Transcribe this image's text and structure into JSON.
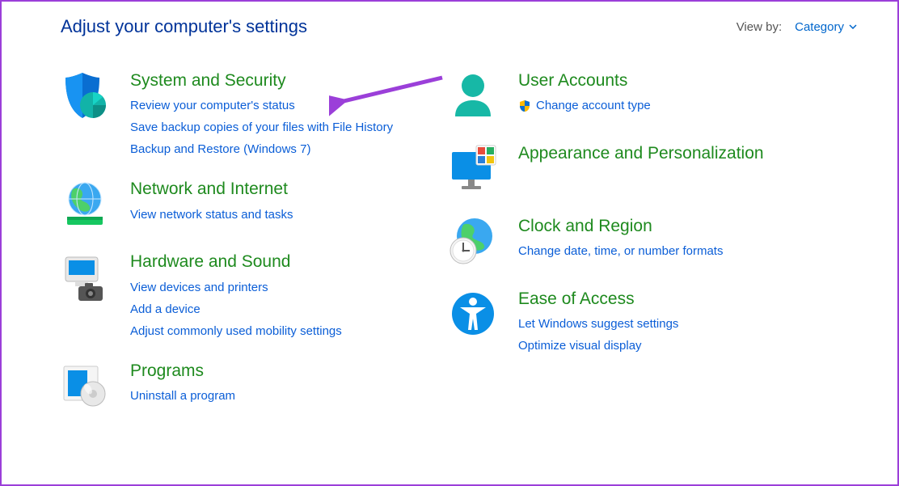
{
  "header": {
    "title": "Adjust your computer's settings",
    "viewby_label": "View by:",
    "viewby_mode": "Category"
  },
  "left": [
    {
      "title": "System and Security",
      "links": [
        "Review your computer's status",
        "Save backup copies of your files with File History",
        "Backup and Restore (Windows 7)"
      ]
    },
    {
      "title": "Network and Internet",
      "links": [
        "View network status and tasks"
      ]
    },
    {
      "title": "Hardware and Sound",
      "links": [
        "View devices and printers",
        "Add a device",
        "Adjust commonly used mobility settings"
      ]
    },
    {
      "title": "Programs",
      "links": [
        "Uninstall a program"
      ]
    }
  ],
  "right": [
    {
      "title": "User Accounts",
      "links": [
        "Change account type"
      ],
      "shield": true
    },
    {
      "title": "Appearance and Personalization",
      "links": []
    },
    {
      "title": "Clock and Region",
      "links": [
        "Change date, time, or number formats"
      ]
    },
    {
      "title": "Ease of Access",
      "links": [
        "Let Windows suggest settings",
        "Optimize visual display"
      ]
    }
  ]
}
